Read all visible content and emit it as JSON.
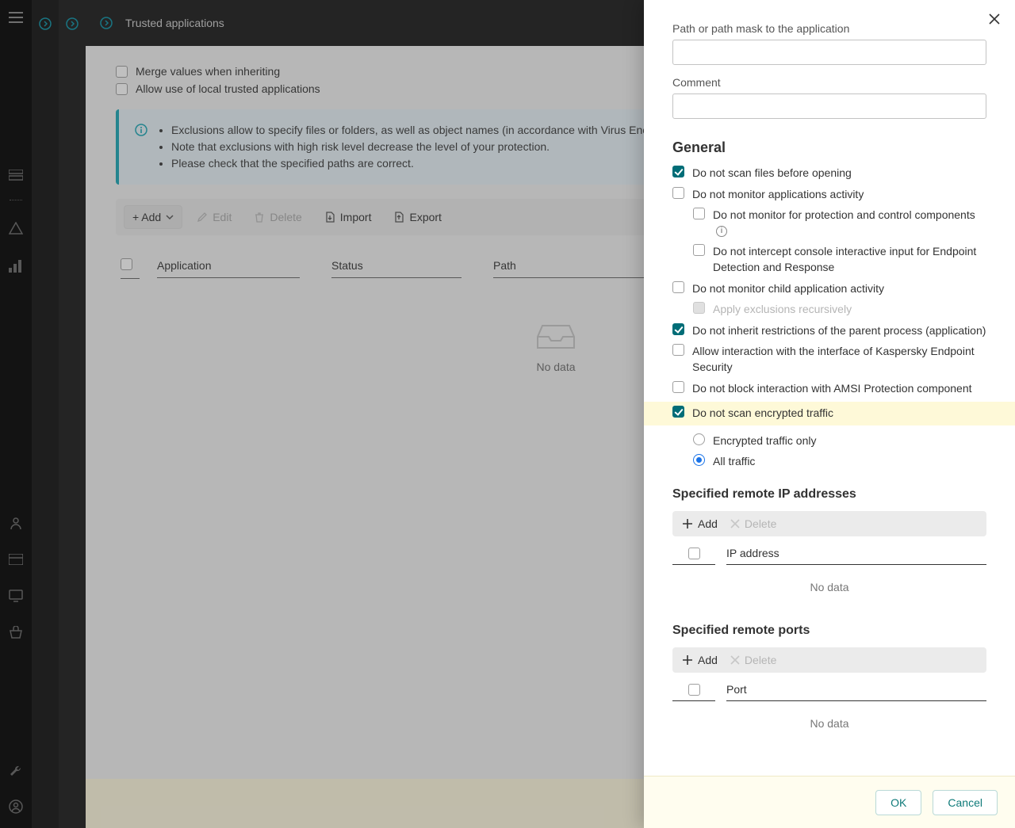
{
  "header": {
    "title": "Trusted applications"
  },
  "page": {
    "mergeInheriting": "Merge values when inheriting",
    "allowLocal": "Allow use of local trusted applications",
    "info": {
      "line1": "Exclusions allow to specify files or folders, as well as object names (in accordance with Virus Encyclopedia), to be excluded from scan by application components.",
      "line2": "Note that exclusions with high risk level decrease the level of your protection.",
      "line3": "Please check that the specified paths are correct."
    }
  },
  "toolbar": {
    "add": "+ Add",
    "edit": "Edit",
    "delete": "Delete",
    "import": "Import",
    "export": "Export"
  },
  "table": {
    "col1": "Application",
    "col2": "Status",
    "col3": "Path",
    "nodata": "No data"
  },
  "panel": {
    "pathLabel": "Path or path mask to the application",
    "commentLabel": "Comment",
    "generalTitle": "General",
    "options": {
      "noScanBeforeOpen": "Do not scan files before opening",
      "noMonitorActivity": "Do not monitor applications activity",
      "noMonitorProtection": "Do not monitor for protection and control components",
      "noInterceptConsole": "Do not intercept console interactive input for Endpoint Detection and Response",
      "noMonitorChild": "Do not monitor child application activity",
      "applyRecursively": "Apply exclusions recursively",
      "noInheritRestrictions": "Do not inherit restrictions of the parent process (application)",
      "allowInteractionKES": "Allow interaction with the interface of Kaspersky Endpoint Security",
      "noBlockAmsi": "Do not block interaction with AMSI Protection component",
      "noScanEncrypted": "Do not scan encrypted traffic",
      "radioEncryptedOnly": "Encrypted traffic only",
      "radioAllTraffic": "All traffic"
    },
    "ipSection": {
      "title": "Specified remote IP addresses",
      "add": "Add",
      "delete": "Delete",
      "col": "IP address",
      "nodata": "No data"
    },
    "portSection": {
      "title": "Specified remote ports",
      "add": "Add",
      "delete": "Delete",
      "col": "Port",
      "nodata": "No data"
    },
    "buttons": {
      "ok": "OK",
      "cancel": "Cancel"
    }
  }
}
